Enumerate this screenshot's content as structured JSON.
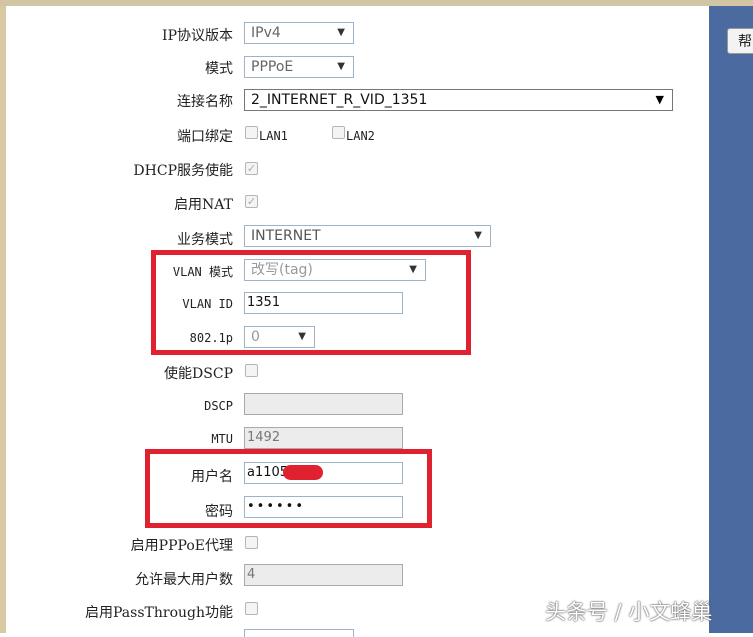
{
  "help_label": "帮",
  "fields": {
    "ip_protocol": {
      "label": "IP协议版本",
      "value": "IPv4"
    },
    "mode": {
      "label": "模式",
      "value": "PPPoE"
    },
    "connection_name": {
      "label": "连接名称",
      "value": "2_INTERNET_R_VID_1351"
    },
    "port_binding": {
      "label": "端口绑定",
      "options": [
        "LAN1",
        "LAN2"
      ]
    },
    "dhcp_service": {
      "label": "DHCP服务使能",
      "checked": true
    },
    "enable_nat": {
      "label": "启用NAT",
      "checked": true
    },
    "service_mode": {
      "label": "业务模式",
      "value": "INTERNET"
    },
    "vlan_mode": {
      "label": "VLAN 模式",
      "value": "改写(tag)"
    },
    "vlan_id": {
      "label": "VLAN ID",
      "value": "1351"
    },
    "dot1p": {
      "label": "802.1p",
      "value": "0"
    },
    "enable_dscp": {
      "label": "使能DSCP",
      "checked": false
    },
    "dscp": {
      "label": "DSCP",
      "value": ""
    },
    "mtu": {
      "label": "MTU",
      "value": "1492"
    },
    "username": {
      "label": "用户名",
      "value": "a1105...7"
    },
    "password": {
      "label": "密码",
      "value": "••••••"
    },
    "pppoe_proxy": {
      "label": "启用PPPoE代理",
      "checked": false
    },
    "max_users": {
      "label": "允许最大用户数",
      "value": "4"
    },
    "passthrough": {
      "label": "启用PassThrough功能",
      "checked": false
    }
  },
  "watermark": "头条号 / 小文蜂巢",
  "colors": {
    "highlight": "#e0212f",
    "side_panel": "#4a6aa0"
  }
}
